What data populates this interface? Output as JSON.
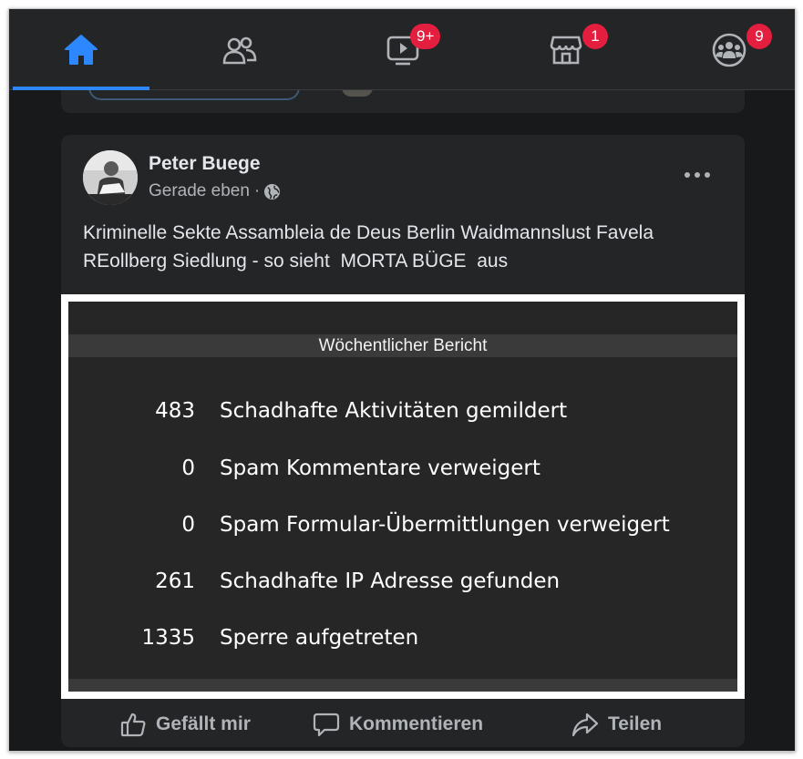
{
  "nav": {
    "tabs": [
      {
        "icon": "home-icon",
        "active": true,
        "badge": ""
      },
      {
        "icon": "friends-icon",
        "active": false,
        "badge": ""
      },
      {
        "icon": "watch-video-icon",
        "active": false,
        "badge": "9+"
      },
      {
        "icon": "marketplace-icon",
        "active": false,
        "badge": "1"
      },
      {
        "icon": "groups-icon",
        "active": false,
        "badge": "9"
      }
    ],
    "accent_color": "#2d88ff",
    "badge_color": "#e41e3f"
  },
  "post": {
    "author": "Peter Buege",
    "time": "Gerade eben",
    "separator": "·",
    "privacy_icon": "globe-icon",
    "text": "Kriminelle Sekte Assambleia de Deus Berlin Waidmannslust Favela REollberg Siedlung - so sieht  MORTA BÜGE  aus",
    "image": {
      "title": "Wöchentlicher Bericht",
      "rows": [
        {
          "value": "483",
          "label": "Schadhafte Aktivitäten gemildert"
        },
        {
          "value": "0",
          "label": "Spam Kommentare verweigert"
        },
        {
          "value": "0",
          "label": "Spam Formular-Übermittlungen verweigert"
        },
        {
          "value": "261",
          "label": "Schadhafte IP Adresse gefunden"
        },
        {
          "value": "1335",
          "label": "Sperre aufgetreten"
        }
      ]
    },
    "actions": {
      "like": "Gefällt mir",
      "comment": "Kommentieren",
      "share": "Teilen"
    }
  }
}
